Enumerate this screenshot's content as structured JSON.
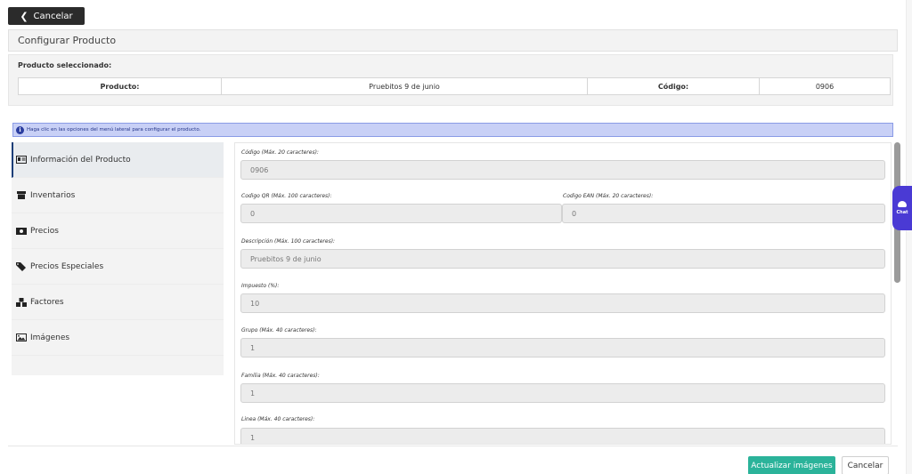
{
  "top": {
    "cancel_label": "Cancelar"
  },
  "header": {
    "title": "Configurar Producto"
  },
  "selected": {
    "caption": "Producto seleccionado:",
    "product_label": "Producto:",
    "product_value": "Pruebitos 9 de junio",
    "code_label": "Código:",
    "code_value": "0906"
  },
  "info": {
    "text": "Haga clic en las opciones del menú lateral para configurar el producto."
  },
  "sidebar": {
    "items": [
      {
        "label": "Información del Producto",
        "icon": "id-card-icon"
      },
      {
        "label": "Inventarios",
        "icon": "archive-icon"
      },
      {
        "label": "Precios",
        "icon": "money-bill-icon"
      },
      {
        "label": "Precios Especiales",
        "icon": "tags-icon"
      },
      {
        "label": "Factores",
        "icon": "cubes-icon"
      },
      {
        "label": "Imágenes",
        "icon": "image-icon"
      }
    ]
  },
  "form": {
    "codigo": {
      "label": "Código (Máx. 20 caracteres):",
      "value": "0906"
    },
    "codigo_qr": {
      "label": "Codigo QR (Máx. 100 caracteres):",
      "value": "0"
    },
    "codigo_ean": {
      "label": "Codigo EAN (Máx. 20 caracteres):",
      "value": "0"
    },
    "descripcion": {
      "label": "Descripción (Máx. 100 caracteres):",
      "value": "Pruebitos 9 de junio"
    },
    "impuesto": {
      "label": "Impuesto (%):",
      "value": "10"
    },
    "grupo": {
      "label": "Grupo (Máx. 40 caracteres):",
      "value": "1"
    },
    "familia": {
      "label": "Familia (Máx. 40 caracteres):",
      "value": "1"
    },
    "linea": {
      "label": "Linea (Máx. 40 caracteres):",
      "value": "1"
    }
  },
  "chat": {
    "label": "Chat"
  },
  "footer": {
    "update_label": "Actualizar imágenes",
    "cancel_label": "Cancelar"
  },
  "colors": {
    "accent": "#2bb39a",
    "dark_button": "#2b2b2b",
    "info_bg": "#c8d0f6",
    "chat": "#4a3ad4"
  }
}
